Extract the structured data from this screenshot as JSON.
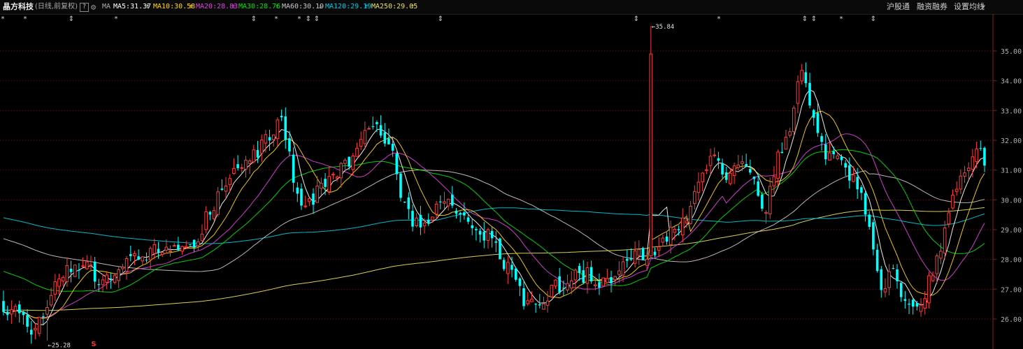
{
  "header": {
    "stock_name": "晶方科技",
    "period_label": "(日线,前复权)",
    "help_icon": "?",
    "settings_icon": "gear-icon",
    "ma_label": "MA",
    "ma_items": [
      {
        "text": "MA5:31.37",
        "arrow": "↑",
        "color": "#ffffff"
      },
      {
        "text": "MA10:30.58",
        "arrow": "↑",
        "color": "#ffd700"
      },
      {
        "text": "MA20:28.83",
        "arrow": "↑",
        "color": "#e040e0"
      },
      {
        "text": "MA30:28.76",
        "arrow": "↑",
        "color": "#00e000"
      },
      {
        "text": "MA60:30.19",
        "arrow": "↓",
        "color": "#c8c8c8"
      },
      {
        "text": "MA120:29.19",
        "arrow": "↑",
        "color": "#00c8e0"
      },
      {
        "text": "MA250:29.05",
        "arrow": "↑",
        "color": "#e8e060"
      }
    ],
    "buttons": {
      "hgt": "沪股通",
      "margin": "融资融券",
      "settings": "设置均线"
    }
  },
  "annotations": {
    "high_label": "35.84",
    "low_label": "25.28",
    "signal_label": "S"
  },
  "chart_data": {
    "type": "candlestick",
    "y_ticks": [
      26.0,
      27.0,
      28.0,
      29.0,
      30.0,
      31.0,
      32.0,
      33.0,
      34.0,
      35.0
    ],
    "ylim": [
      25.17,
      36.45
    ],
    "high": 35.84,
    "low": 25.28,
    "close_last": 31.4,
    "up_color": "#ff3c3c",
    "down_color": "#00ffff",
    "ma_colors": {
      "MA5": "#ffffff",
      "MA10": "#ffd700",
      "MA20": "#e040e0",
      "MA30": "#00e000",
      "MA60": "#c8c8c8",
      "MA120": "#00c8e0",
      "MA250": "#e8e060"
    }
  }
}
